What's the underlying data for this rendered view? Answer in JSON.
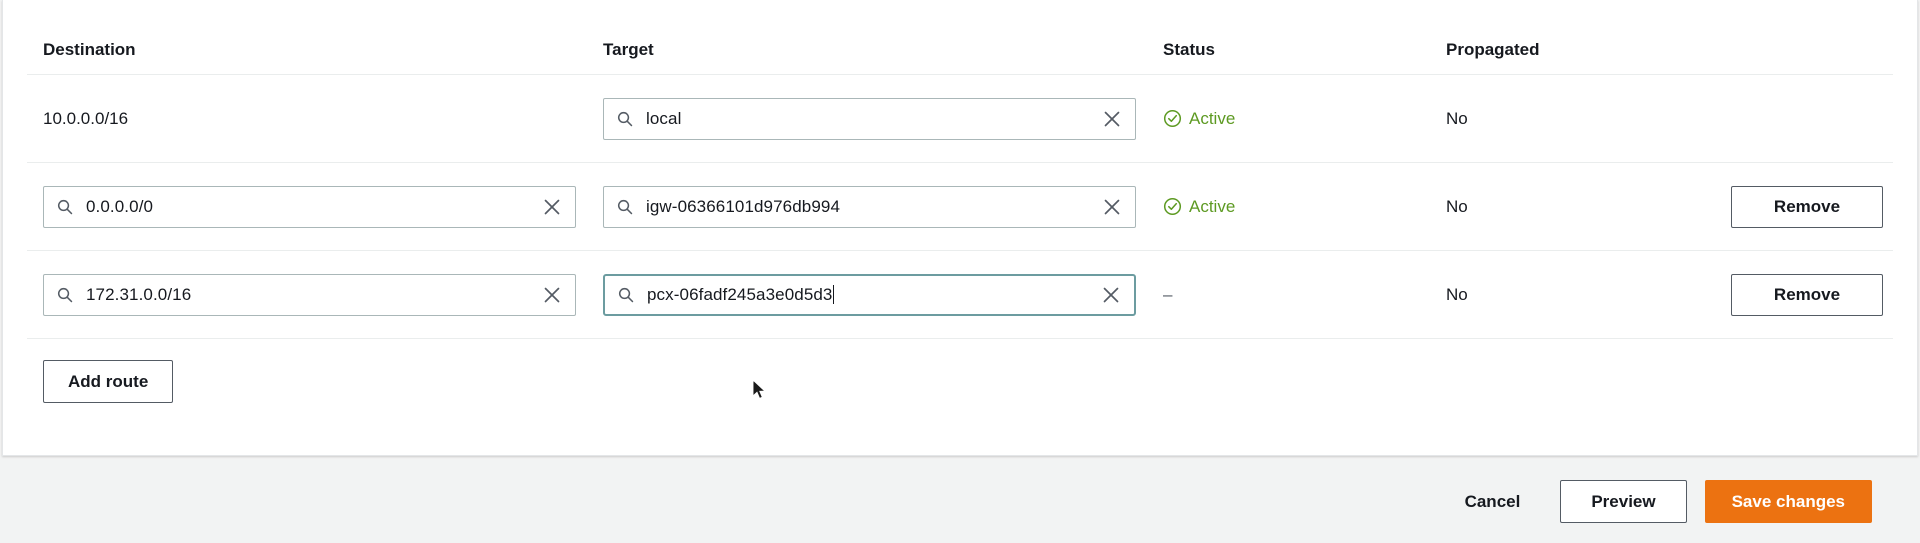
{
  "table": {
    "columns": [
      {
        "key": "destination",
        "label": "Destination"
      },
      {
        "key": "target",
        "label": "Target"
      },
      {
        "key": "status",
        "label": "Status"
      },
      {
        "key": "propagated",
        "label": "Propagated"
      }
    ],
    "rows": [
      {
        "destination_value": "10.0.0.0/16",
        "destination_editable": false,
        "target_value": "local",
        "target_focused": false,
        "status": "Active",
        "status_type": "active",
        "propagated": "No",
        "remove_label": "",
        "has_remove": false
      },
      {
        "destination_value": "0.0.0.0/0",
        "destination_editable": true,
        "target_value": "igw-06366101d976db994",
        "target_focused": false,
        "status": "Active",
        "status_type": "active",
        "propagated": "No",
        "remove_label": "Remove",
        "has_remove": true
      },
      {
        "destination_value": "172.31.0.0/16",
        "destination_editable": true,
        "target_value": "pcx-06fadf245a3e0d5d3",
        "target_focused": true,
        "status": "–",
        "status_type": "none",
        "propagated": "No",
        "remove_label": "Remove",
        "has_remove": true
      }
    ]
  },
  "actions": {
    "add_route_label": "Add route"
  },
  "footer": {
    "cancel_label": "Cancel",
    "preview_label": "Preview",
    "save_label": "Save changes"
  },
  "icons": {
    "search": "search-icon",
    "clear": "close-icon",
    "status_active": "check-circle-icon",
    "cursor": "mouse-pointer-icon"
  },
  "colors": {
    "accent_orange": "#ec7211",
    "status_green": "#5d9a22",
    "focus_teal": "#6c9ca0",
    "border_gray": "#aab7b8",
    "page_bg": "#f2f3f3"
  }
}
